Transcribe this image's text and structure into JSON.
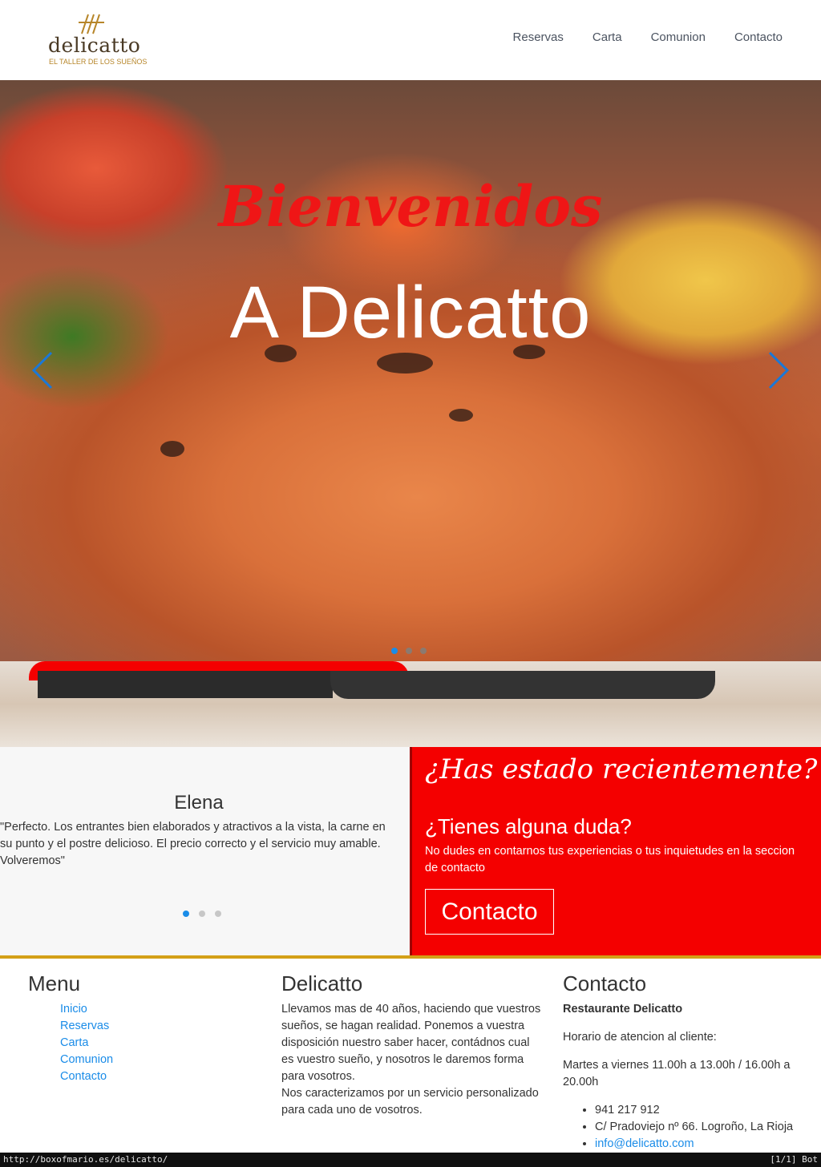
{
  "header": {
    "logo_word": "delicatto",
    "logo_tagline": "EL TALLER DE LOS SUEÑOS",
    "nav": [
      "Reservas",
      "Carta",
      "Comunion",
      "Contacto"
    ]
  },
  "hero": {
    "title_script": "Bienvenidos",
    "title_main": "A Delicatto",
    "prev_icon": "chevron-left-icon",
    "next_icon": "chevron-right-icon",
    "slides_count": 3,
    "active_slide": 1
  },
  "testimonial": {
    "name": "Elena",
    "text": "\"Perfecto. Los entrantes bien elaborados y atractivos a la vista, la carne en su punto y el postre delicioso. El precio correcto y el servicio muy amable. Volveremos\"",
    "slides_count": 3,
    "active_slide": 1
  },
  "cta": {
    "title": "¿Has estado recientemente?",
    "subtitle": "¿Tienes alguna duda?",
    "text": "No dudes en contarnos tus experiencias o tus inquietudes en la seccion de contacto",
    "button": "Contacto"
  },
  "footer": {
    "menu": {
      "title": "Menu",
      "items": [
        "Inicio",
        "Reservas",
        "Carta",
        "Comunion",
        "Contacto"
      ]
    },
    "about": {
      "title": "Delicatto",
      "p1": "Llevamos mas de 40 años, haciendo que vuestros sueños, se hagan realidad. Ponemos a vuestra disposición nuestro saber hacer, contádnos cual es vuestro sueño, y nosotros le daremos forma para vosotros.",
      "p2": "Nos caracterizamos por un servicio personalizado para cada uno de vosotros."
    },
    "contact": {
      "title": "Contacto",
      "name": "Restaurante Delicatto",
      "hours_label": "Horario de atencion al cliente:",
      "hours": "Martes a viernes 11.00h a 13.00h / 16.00h a 20.00h",
      "phone": " 941 217 912",
      "address": "C/ Pradoviejo nº 66. Logroño, La Rioja",
      "email": "info@delicatto.com"
    }
  },
  "statusbar": {
    "url": "http://boxofmario.es/delicatto/",
    "position": "[1/1] Bot"
  },
  "colors": {
    "accent_red": "#f40000",
    "link_blue": "#1a8ce8",
    "gold": "#d4a017"
  }
}
